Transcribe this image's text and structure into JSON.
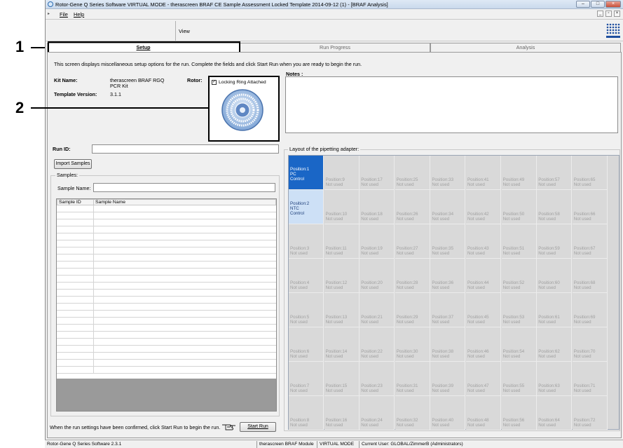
{
  "window": {
    "title": "Rotor-Gene Q Series Software VIRTUAL MODE - therascreen BRAF CE Sample Assessment Locked Template 2014-09-12 (1) - [BRAF Analysis]"
  },
  "menu": {
    "file": "File",
    "help": "Help"
  },
  "toolbar": {
    "view": "View"
  },
  "callouts": {
    "one": "1",
    "two": "2"
  },
  "tabs": [
    {
      "label": "Setup"
    },
    {
      "label": "Run Progress"
    },
    {
      "label": "Analysis"
    }
  ],
  "setup": {
    "intro": "This screen displays miscellaneous setup options for the run. Complete the fields and click Start Run when you are ready to begin the run.",
    "kit_label": "Kit Name:",
    "kit_value_line1": "therascreen BRAF RGQ",
    "kit_value_line2": "PCR Kit",
    "template_label": "Template Version:",
    "template_value": "3.1.1",
    "rotor_label": "Rotor:",
    "locking_ring": "Locking Ring Attached",
    "notes_label": "Notes :",
    "run_id_label": "Run ID:",
    "run_id_value": "",
    "import_button": "Import Samples",
    "samples_group": "Samples:",
    "sample_name_label": "Sample Name:",
    "sample_name_value": "",
    "col_sample_id": "Sample ID",
    "col_sample_name": "Sample Name",
    "confirm_text": "When the run settings have been confirmed, click Start Run to begin the run.",
    "start_button": "Start Run",
    "layout_title": "Layout of the pipetting adapter:"
  },
  "positions": [
    {
      "line1": "Position:1",
      "line2": "PC",
      "line3": "Control"
    },
    {
      "line1": "Position:2",
      "line2": "NTC",
      "line3": "Control"
    },
    {
      "line1": "Position:3",
      "line2": "Not used",
      "line3": ""
    },
    {
      "line1": "Position:4",
      "line2": "Not used",
      "line3": ""
    },
    {
      "line1": "Position:5",
      "line2": "Not used",
      "line3": ""
    },
    {
      "line1": "Position:6",
      "line2": "Not used",
      "line3": ""
    },
    {
      "line1": "Position:7",
      "line2": "Not used",
      "line3": ""
    },
    {
      "line1": "Position:8",
      "line2": "Not used",
      "line3": ""
    },
    {
      "line1": "Position:9",
      "line2": "Not used",
      "line3": ""
    },
    {
      "line1": "Position:10",
      "line2": "Not used",
      "line3": ""
    },
    {
      "line1": "Position:11",
      "line2": "Not used",
      "line3": ""
    },
    {
      "line1": "Position:12",
      "line2": "Not used",
      "line3": ""
    },
    {
      "line1": "Position:13",
      "line2": "Not used",
      "line3": ""
    },
    {
      "line1": "Position:14",
      "line2": "Not used",
      "line3": ""
    },
    {
      "line1": "Position:15",
      "line2": "Not used",
      "line3": ""
    },
    {
      "line1": "Position:16",
      "line2": "Not used",
      "line3": ""
    },
    {
      "line1": "Position:17",
      "line2": "Not used",
      "line3": ""
    },
    {
      "line1": "Position:18",
      "line2": "Not used",
      "line3": ""
    },
    {
      "line1": "Position:19",
      "line2": "Not used",
      "line3": ""
    },
    {
      "line1": "Position:20",
      "line2": "Not used",
      "line3": ""
    },
    {
      "line1": "Position:21",
      "line2": "Not used",
      "line3": ""
    },
    {
      "line1": "Position:22",
      "line2": "Not used",
      "line3": ""
    },
    {
      "line1": "Position:23",
      "line2": "Not used",
      "line3": ""
    },
    {
      "line1": "Position:24",
      "line2": "Not used",
      "line3": ""
    },
    {
      "line1": "Position:25",
      "line2": "Not used",
      "line3": ""
    },
    {
      "line1": "Position:26",
      "line2": "Not used",
      "line3": ""
    },
    {
      "line1": "Position:27",
      "line2": "Not used",
      "line3": ""
    },
    {
      "line1": "Position:28",
      "line2": "Not used",
      "line3": ""
    },
    {
      "line1": "Position:29",
      "line2": "Not used",
      "line3": ""
    },
    {
      "line1": "Position:30",
      "line2": "Not used",
      "line3": ""
    },
    {
      "line1": "Position:31",
      "line2": "Not used",
      "line3": ""
    },
    {
      "line1": "Position:32",
      "line2": "Not used",
      "line3": ""
    },
    {
      "line1": "Position:33",
      "line2": "Not used",
      "line3": ""
    },
    {
      "line1": "Position:34",
      "line2": "Not used",
      "line3": ""
    },
    {
      "line1": "Position:35",
      "line2": "Not used",
      "line3": ""
    },
    {
      "line1": "Position:36",
      "line2": "Not used",
      "line3": ""
    },
    {
      "line1": "Position:37",
      "line2": "Not used",
      "line3": ""
    },
    {
      "line1": "Position:38",
      "line2": "Not used",
      "line3": ""
    },
    {
      "line1": "Position:39",
      "line2": "Not used",
      "line3": ""
    },
    {
      "line1": "Position:40",
      "line2": "Not used",
      "line3": ""
    },
    {
      "line1": "Position:41",
      "line2": "Not used",
      "line3": ""
    },
    {
      "line1": "Position:42",
      "line2": "Not used",
      "line3": ""
    },
    {
      "line1": "Position:43",
      "line2": "Not used",
      "line3": ""
    },
    {
      "line1": "Position:44",
      "line2": "Not used",
      "line3": ""
    },
    {
      "line1": "Position:45",
      "line2": "Not used",
      "line3": ""
    },
    {
      "line1": "Position:46",
      "line2": "Not used",
      "line3": ""
    },
    {
      "line1": "Position:47",
      "line2": "Not used",
      "line3": ""
    },
    {
      "line1": "Position:48",
      "line2": "Not used",
      "line3": ""
    },
    {
      "line1": "Position:49",
      "line2": "Not used",
      "line3": ""
    },
    {
      "line1": "Position:50",
      "line2": "Not used",
      "line3": ""
    },
    {
      "line1": "Position:51",
      "line2": "Not used",
      "line3": ""
    },
    {
      "line1": "Position:52",
      "line2": "Not used",
      "line3": ""
    },
    {
      "line1": "Position:53",
      "line2": "Not used",
      "line3": ""
    },
    {
      "line1": "Position:54",
      "line2": "Not used",
      "line3": ""
    },
    {
      "line1": "Position:55",
      "line2": "Not used",
      "line3": ""
    },
    {
      "line1": "Position:56",
      "line2": "Not used",
      "line3": ""
    },
    {
      "line1": "Position:57",
      "line2": "Not used",
      "line3": ""
    },
    {
      "line1": "Position:58",
      "line2": "Not used",
      "line3": ""
    },
    {
      "line1": "Position:59",
      "line2": "Not used",
      "line3": ""
    },
    {
      "line1": "Position:60",
      "line2": "Not used",
      "line3": ""
    },
    {
      "line1": "Position:61",
      "line2": "Not used",
      "line3": ""
    },
    {
      "line1": "Position:62",
      "line2": "Not used",
      "line3": ""
    },
    {
      "line1": "Position:63",
      "line2": "Not used",
      "line3": ""
    },
    {
      "line1": "Position:64",
      "line2": "Not used",
      "line3": ""
    },
    {
      "line1": "Position:65",
      "line2": "Not used",
      "line3": ""
    },
    {
      "line1": "Position:66",
      "line2": "Not used",
      "line3": ""
    },
    {
      "line1": "Position:67",
      "line2": "Not used",
      "line3": ""
    },
    {
      "line1": "Position:68",
      "line2": "Not used",
      "line3": ""
    },
    {
      "line1": "Position:69",
      "line2": "Not used",
      "line3": ""
    },
    {
      "line1": "Position:70",
      "line2": "Not used",
      "line3": ""
    },
    {
      "line1": "Position:71",
      "line2": "Not used",
      "line3": ""
    },
    {
      "line1": "Position:72",
      "line2": "Not used",
      "line3": ""
    }
  ],
  "statusbar": {
    "version": "Rotor-Gene Q Series Software 2.3.1",
    "module": "therascreen BRAF Module",
    "mode": "VIRTUAL MODE",
    "user": "Current User: GLOBAL/ZimmerB (Administrators)"
  },
  "colors": {
    "selected_cell": "#1a66c6",
    "highlight_cell": "#cde0f6",
    "callout_border": "#000000"
  }
}
